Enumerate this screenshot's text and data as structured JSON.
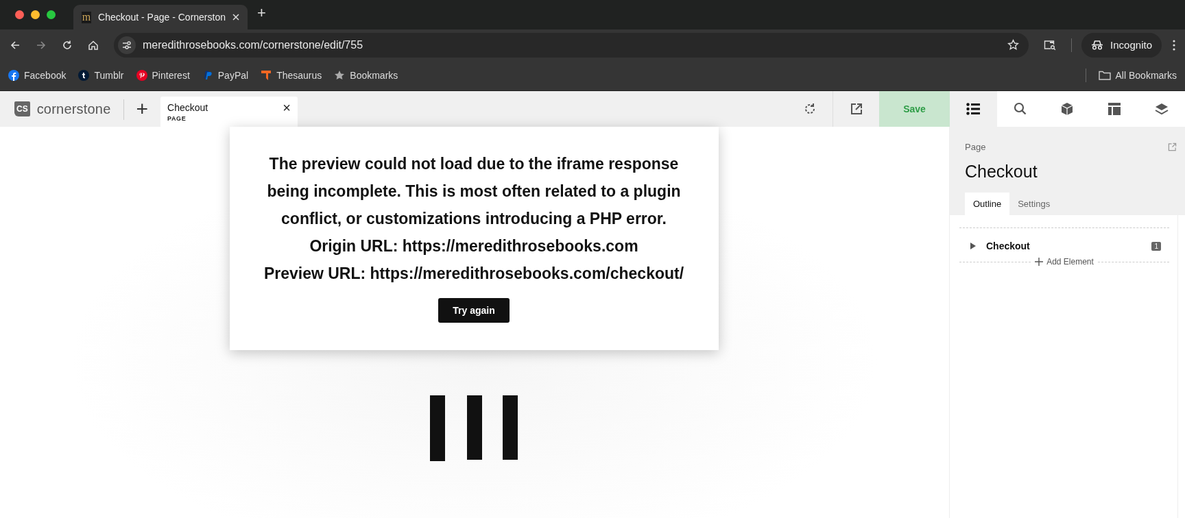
{
  "browser": {
    "tabs": [
      {
        "title": "Checkout - Page - Cornerston",
        "favicon": "m",
        "selected": true
      }
    ],
    "new_tab": "+",
    "address": "meredithrosebooks.com/cornerstone/edit/755",
    "profile": "Incognito",
    "bookmarks": [
      {
        "label": "Facebook",
        "kind": "facebook"
      },
      {
        "label": "Tumblr",
        "kind": "tumblr"
      },
      {
        "label": "Pinterest",
        "kind": "pinterest"
      },
      {
        "label": "PayPal",
        "kind": "paypal"
      },
      {
        "label": "Thesaurus",
        "kind": "thesaurus"
      },
      {
        "label": "Bookmarks",
        "kind": "star"
      }
    ],
    "all_bookmarks": "All Bookmarks"
  },
  "toolbar": {
    "logo_mark": "CS",
    "logo_text": "cornerstone",
    "add": "+",
    "doc_tab": {
      "title": "Checkout",
      "subtitle": "PAGE",
      "close": "×",
      "selected": true
    },
    "save": "Save",
    "panels": [
      {
        "kind": "list",
        "selected": true
      },
      {
        "kind": "search",
        "selected": false
      },
      {
        "kind": "box",
        "selected": false
      },
      {
        "kind": "layout",
        "selected": false
      },
      {
        "kind": "layers",
        "selected": false
      }
    ]
  },
  "dialog": {
    "lines": [
      "The preview could not load due to the iframe response being incomplete. This is most often related to a plugin conflict, or customizations introducing a PHP error.",
      "Origin URL: https://meredithrosebooks.com",
      "Preview URL: https://meredithrosebooks.com/checkout/"
    ],
    "button": "Try again"
  },
  "panel": {
    "label": "Page",
    "title": "Checkout",
    "tabs": [
      {
        "label": "Outline",
        "selected": true
      },
      {
        "label": "Settings",
        "selected": false
      }
    ],
    "outline": [
      {
        "name": "Checkout",
        "count": "1",
        "expanded": false
      }
    ],
    "add_element": "Add Element"
  }
}
